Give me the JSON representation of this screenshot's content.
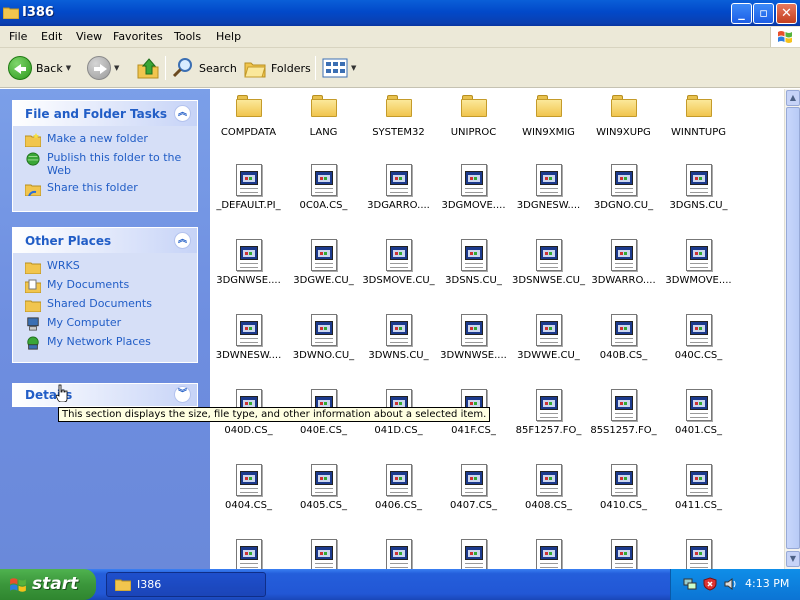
{
  "window": {
    "title": "I386"
  },
  "menu": {
    "items": [
      "File",
      "Edit",
      "View",
      "Favorites",
      "Tools",
      "Help"
    ]
  },
  "toolbar": {
    "back": "Back",
    "search": "Search",
    "folders": "Folders"
  },
  "tasks": {
    "file_folder": {
      "title": "File and Folder Tasks",
      "items": [
        "Make a new folder",
        "Publish this folder to the Web",
        "Share this folder"
      ]
    },
    "other_places": {
      "title": "Other Places",
      "items": [
        "WRKS",
        "My Documents",
        "Shared Documents",
        "My Computer",
        "My Network Places"
      ]
    },
    "details": {
      "title": "Details"
    }
  },
  "tooltip": "This section displays the size, file type, and other information about a selected item.",
  "files": [
    {
      "name": "COMPDATA",
      "type": "folder"
    },
    {
      "name": "LANG",
      "type": "folder"
    },
    {
      "name": "SYSTEM32",
      "type": "folder"
    },
    {
      "name": "UNIPROC",
      "type": "folder"
    },
    {
      "name": "WIN9XMIG",
      "type": "folder"
    },
    {
      "name": "WIN9XUPG",
      "type": "folder"
    },
    {
      "name": "WINNTUPG",
      "type": "folder"
    },
    {
      "name": "_DEFAULT.PI_",
      "type": "file"
    },
    {
      "name": "0C0A.CS_",
      "type": "file"
    },
    {
      "name": "3DGARRO....",
      "type": "file"
    },
    {
      "name": "3DGMOVE....",
      "type": "file"
    },
    {
      "name": "3DGNESW....",
      "type": "file"
    },
    {
      "name": "3DGNO.CU_",
      "type": "file"
    },
    {
      "name": "3DGNS.CU_",
      "type": "file"
    },
    {
      "name": "3DGNWSE....",
      "type": "file"
    },
    {
      "name": "3DGWE.CU_",
      "type": "file"
    },
    {
      "name": "3DSMOVE.CU_",
      "type": "file"
    },
    {
      "name": "3DSNS.CU_",
      "type": "file"
    },
    {
      "name": "3DSNWSE.CU_",
      "type": "file"
    },
    {
      "name": "3DWARRO....",
      "type": "file"
    },
    {
      "name": "3DWMOVE....",
      "type": "file"
    },
    {
      "name": "3DWNESW....",
      "type": "file"
    },
    {
      "name": "3DWNO.CU_",
      "type": "file"
    },
    {
      "name": "3DWNS.CU_",
      "type": "file"
    },
    {
      "name": "3DWNWSE....",
      "type": "file"
    },
    {
      "name": "3DWWE.CU_",
      "type": "file"
    },
    {
      "name": "040B.CS_",
      "type": "file"
    },
    {
      "name": "040C.CS_",
      "type": "file"
    },
    {
      "name": "040D.CS_",
      "type": "file"
    },
    {
      "name": "040E.CS_",
      "type": "file"
    },
    {
      "name": "041D.CS_",
      "type": "file"
    },
    {
      "name": "041F.CS_",
      "type": "file"
    },
    {
      "name": "85F1257.FO_",
      "type": "file"
    },
    {
      "name": "85S1257.FO_",
      "type": "file"
    },
    {
      "name": "0401.CS_",
      "type": "file"
    },
    {
      "name": "0404.CS_",
      "type": "file"
    },
    {
      "name": "0405.CS_",
      "type": "file"
    },
    {
      "name": "0406.CS_",
      "type": "file"
    },
    {
      "name": "0407.CS_",
      "type": "file"
    },
    {
      "name": "0408.CS_",
      "type": "file"
    },
    {
      "name": "0410.CS_",
      "type": "file"
    },
    {
      "name": "0411.CS_",
      "type": "file"
    },
    {
      "name": "",
      "type": "file"
    },
    {
      "name": "",
      "type": "file"
    },
    {
      "name": "",
      "type": "file"
    },
    {
      "name": "",
      "type": "file"
    },
    {
      "name": "",
      "type": "file"
    },
    {
      "name": "",
      "type": "file"
    },
    {
      "name": "",
      "type": "file"
    }
  ],
  "taskbar": {
    "start": "start",
    "task": "I386",
    "clock": "4:13 PM"
  }
}
